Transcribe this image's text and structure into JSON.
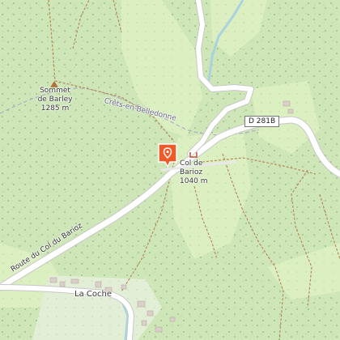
{
  "map": {
    "colors": {
      "forest": "#cfe6b8",
      "meadow": "#dcefc1",
      "road": "#ffffff",
      "road_edge": "#c8c8c8",
      "path": "#b68a5e",
      "water": "#aad3df",
      "pin": "#f05a28"
    },
    "labels": {
      "peak_name": "Sommet\nde Barley",
      "peak_ele": "1285 m",
      "ridge": "Crêts-en-Belledonne",
      "pass_name": "Col de\nBarioz",
      "pass_ele": "1040 m",
      "road_name": "Route du Col du Barioz",
      "road_ref": "D 281B",
      "hamlet": "La Coche"
    },
    "icons": {
      "peak": "triangle-icon",
      "pass": "pass-icon",
      "marker": "location-pin-icon"
    }
  }
}
